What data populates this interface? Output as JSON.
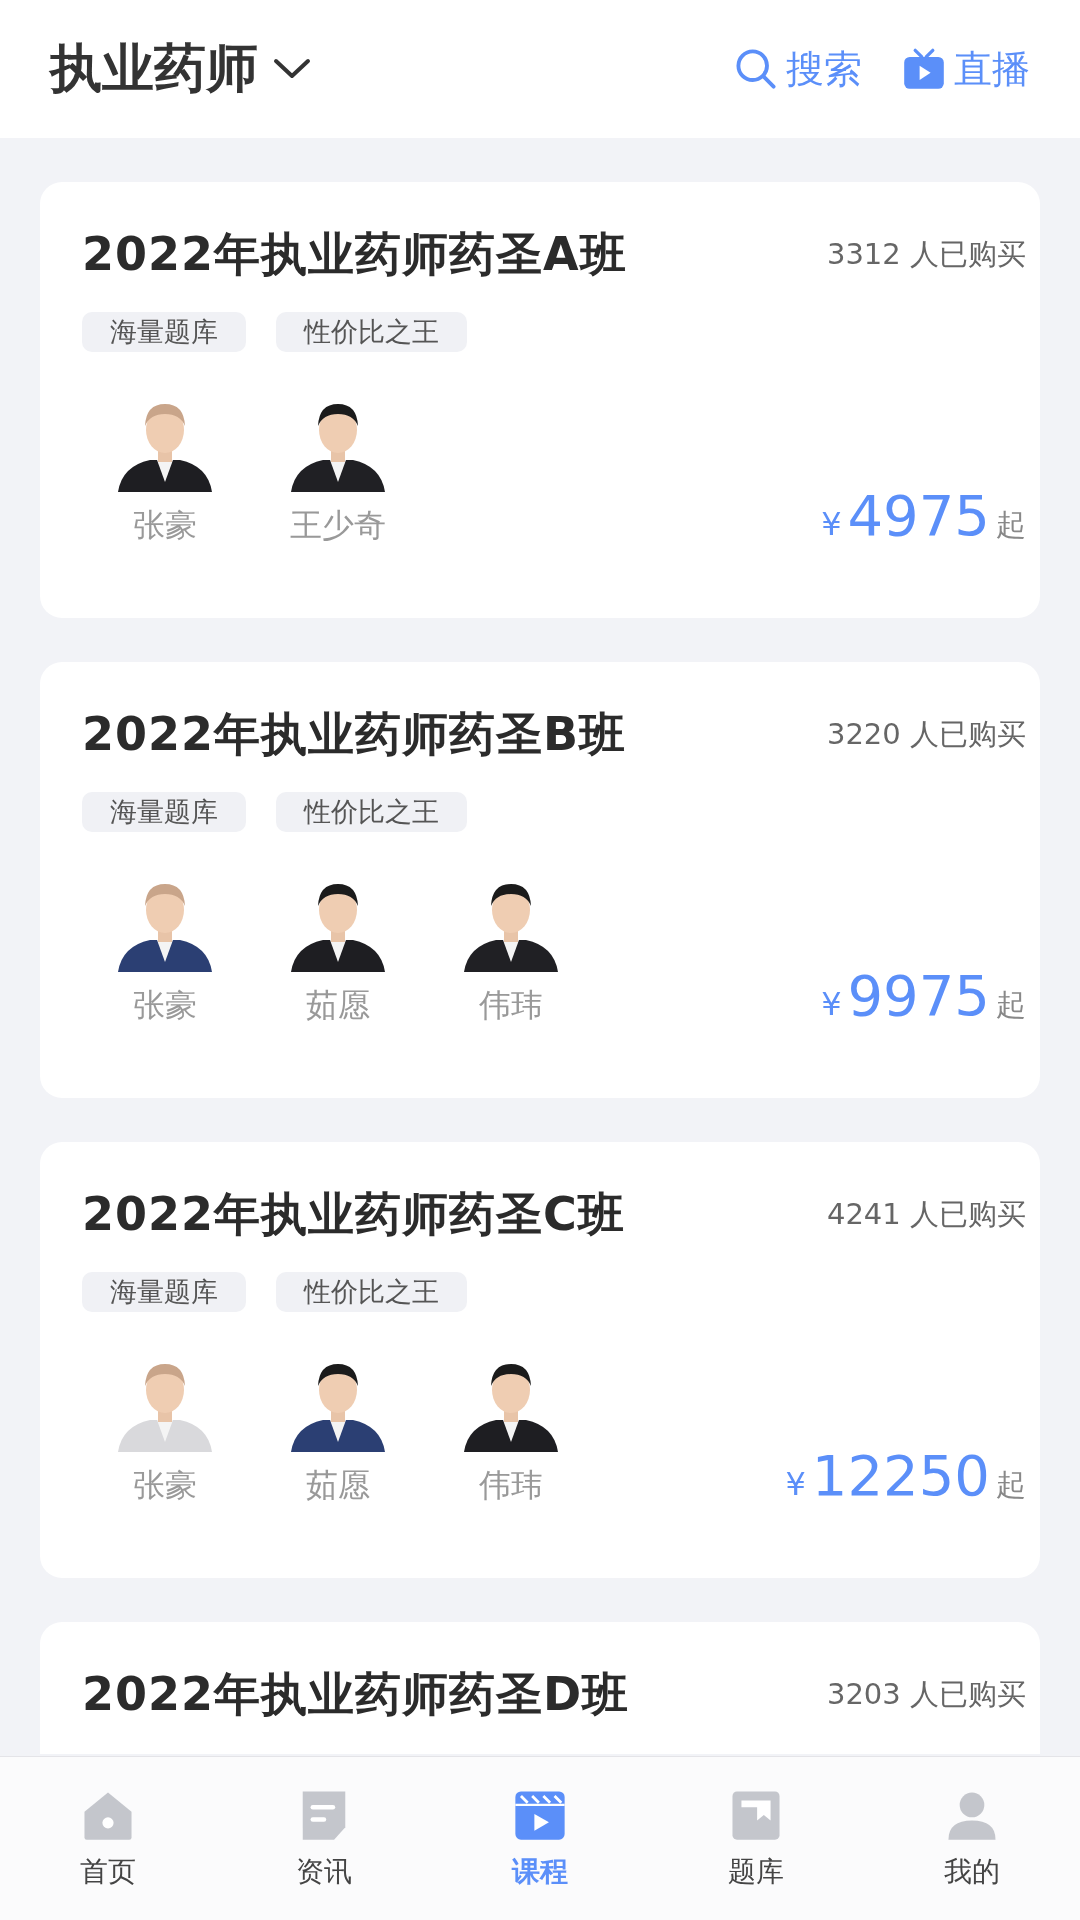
{
  "header": {
    "title": "执业药师",
    "search": "搜索",
    "live": "直播"
  },
  "courses": [
    {
      "title": "2022年执业药师药圣A班",
      "buyers": "3312 人已购买",
      "tags": [
        "海量题库",
        "性价比之王"
      ],
      "teachers": [
        "张豪",
        "王少奇"
      ],
      "currency": "¥",
      "price": "4975",
      "suffix": "起"
    },
    {
      "title": "2022年执业药师药圣B班",
      "buyers": "3220 人已购买",
      "tags": [
        "海量题库",
        "性价比之王"
      ],
      "teachers": [
        "张豪",
        "茹愿",
        "伟玮"
      ],
      "currency": "¥",
      "price": "9975",
      "suffix": "起"
    },
    {
      "title": "2022年执业药师药圣C班",
      "buyers": "4241 人已购买",
      "tags": [
        "海量题库",
        "性价比之王"
      ],
      "teachers": [
        "张豪",
        "茹愿",
        "伟玮"
      ],
      "currency": "¥",
      "price": "12250",
      "suffix": "起"
    },
    {
      "title": "2022年执业药师药圣D班",
      "buyers": "3203 人已购买"
    }
  ],
  "nav": [
    {
      "label": "首页",
      "kind": "home",
      "selected": false
    },
    {
      "label": "资讯",
      "kind": "news",
      "selected": false
    },
    {
      "label": "课程",
      "kind": "course",
      "selected": true
    },
    {
      "label": "题库",
      "kind": "bank",
      "selected": false
    },
    {
      "label": "我的",
      "kind": "me",
      "selected": false
    }
  ]
}
